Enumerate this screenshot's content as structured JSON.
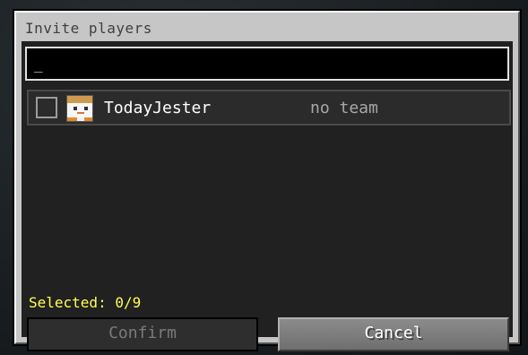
{
  "dialog": {
    "title": "Invite players"
  },
  "search": {
    "value": "_"
  },
  "players": [
    {
      "name": "TodayJester",
      "team": "no team",
      "checked": false
    }
  ],
  "status": {
    "selected_text": "Selected: 0/9"
  },
  "buttons": {
    "confirm_label": "Confirm",
    "cancel_label": "Cancel"
  },
  "colors": {
    "selected_text": "#ffff55",
    "dialog_bg": "#c6c6c6",
    "panel_bg": "#212121"
  }
}
